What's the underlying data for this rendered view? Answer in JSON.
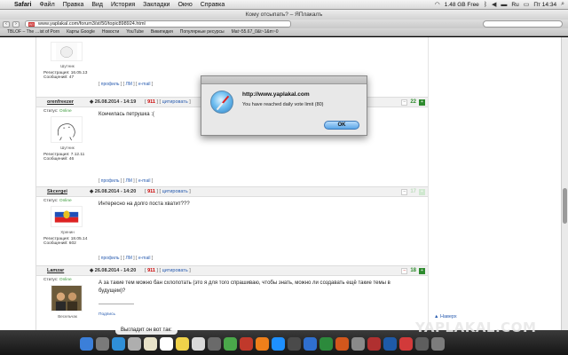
{
  "menubar": {
    "items": [
      "Safari",
      "Файл",
      "Правка",
      "Вид",
      "История",
      "Закладки",
      "Окно",
      "Справка"
    ],
    "status": {
      "disk": "1.48 GB Free",
      "lang": "Ru",
      "time": "Пт 14:34"
    }
  },
  "window": {
    "title": "Кому отсыпать? – ЯПлакалъ"
  },
  "toolbar": {
    "url": "www.yaplakal.com/forum3/st/50/topic898924.html",
    "favicon": "ЯП"
  },
  "bookmarks": [
    "TBLOF – The …ist of Porn",
    "Карты Google",
    "Новости",
    "YouTube",
    "Википедия",
    "Популярные ресурсы",
    "Mat~55.67_0&t~1&m~0"
  ],
  "posts": [
    {
      "profile_links": [
        "профиль",
        "ЛМ",
        "e-mail"
      ],
      "avatar_caption": "Шутник",
      "registered": "Регистрация: 16.05.13",
      "messages": "Сообщений: 47"
    },
    {
      "username": "orenfreezer",
      "date": "26.08.2014 - 14:19",
      "post_id": "911",
      "quote": "цитировать",
      "status_label": "Статус:",
      "status": "Online",
      "avatar_caption": "Шутник",
      "registered": "Регистрация: 7.12.11",
      "messages": "Сообщений: 46",
      "text": "Кончилась петрушка :(",
      "votes": "22",
      "profile_links": [
        "профиль",
        "ЛМ",
        "e-mail"
      ]
    },
    {
      "username": "Skcergei",
      "date": "26.08.2014 - 14:20",
      "post_id": "911",
      "quote": "цитировать",
      "status_label": "Статус:",
      "status": "Online",
      "avatar_caption": "Хренин",
      "registered": "Регистрация: 18.05.14",
      "messages": "Сообщений: 602",
      "text": "Интересно на долго поста хватит???",
      "votes": "17",
      "profile_links": [
        "профиль",
        "ЛМ",
        "e-mail"
      ]
    },
    {
      "username": "Lamzar",
      "date": "26.08.2014 - 14:20",
      "post_id": "911",
      "quote": "цитировать",
      "status_label": "Статус:",
      "status": "Online",
      "avatar_caption": "Весельчак",
      "text": "А за такие тем можно бан схлопотать (это я для того спрашиваю, чтобы знать, можно ли создавать ещё такие темы в будущем)?",
      "separator": "--------------------",
      "signature": "Подпись",
      "votes": "18"
    }
  ],
  "sidebar": {
    "back_to_top": "▲ Наверх"
  },
  "alert": {
    "title": "http://www.yaplakal.com",
    "message": "You have reached daily vote limit (80)",
    "ok": "OK"
  },
  "dock": {
    "tooltip": "Выгладит он вот так:"
  },
  "watermark": "YAPLAKAL.COM",
  "colors": {
    "accent_green": "#2e8b2e",
    "link_blue": "#2a5db0",
    "post_red": "#cc0000"
  }
}
